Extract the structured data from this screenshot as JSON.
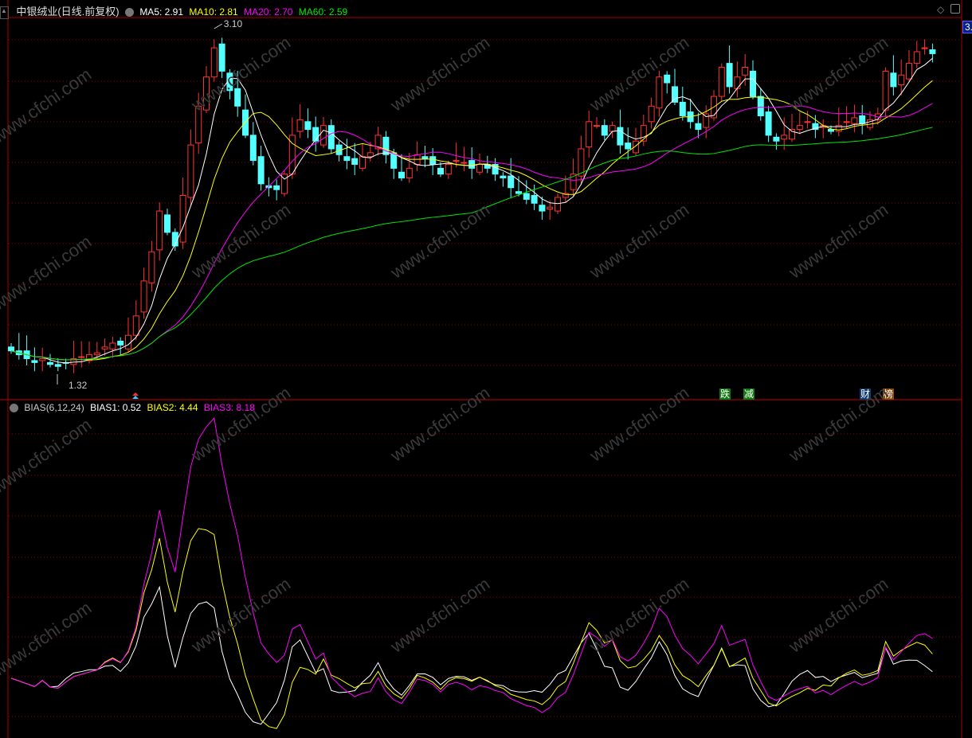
{
  "header": {
    "title": "中银绒业(日线.前复权)",
    "ma5": "MA5: 2.91",
    "ma10": "MA10: 2.81",
    "ma20": "MA20: 2.70",
    "ma60": "MA60: 2.59",
    "price_tag": "3."
  },
  "indicator": {
    "name": "BIAS(6,12,24)",
    "bias1": "BIAS1: 0.52",
    "bias2": "BIAS2: 4.44",
    "bias3": "BIAS3: 8.18"
  },
  "event_tags": [
    "跌",
    "减",
    "财",
    "榜"
  ],
  "watermark": "www.cfchi.com",
  "colors": {
    "up": "#ff3232",
    "down": "#54ffff",
    "ma5": "#ffffff",
    "ma10": "#ffff00",
    "ma20": "#ff00ff",
    "ma60": "#00e600",
    "grid": "#8b0000"
  },
  "chart_data": {
    "type": "candlestick",
    "title": "中银绒业(日线.前复权)",
    "high_label": "3.10",
    "low_label": "1.32",
    "ylim": [
      1.32,
      3.1
    ],
    "closes": [
      1.44,
      1.42,
      1.4,
      1.38,
      1.4,
      1.37,
      1.36,
      1.38,
      1.4,
      1.41,
      1.42,
      1.43,
      1.46,
      1.48,
      1.47,
      1.52,
      1.62,
      1.8,
      1.95,
      2.16,
      2.05,
      1.98,
      2.24,
      2.5,
      2.7,
      2.85,
      3.0,
      2.88,
      2.78,
      2.7,
      2.55,
      2.42,
      2.3,
      2.28,
      2.27,
      2.35,
      2.55,
      2.63,
      2.58,
      2.52,
      2.6,
      2.48,
      2.45,
      2.42,
      2.4,
      2.44,
      2.46,
      2.55,
      2.45,
      2.38,
      2.33,
      2.38,
      2.45,
      2.43,
      2.4,
      2.35,
      2.4,
      2.42,
      2.41,
      2.38,
      2.4,
      2.38,
      2.35,
      2.33,
      2.28,
      2.25,
      2.22,
      2.2,
      2.16,
      2.18,
      2.23,
      2.25,
      2.35,
      2.48,
      2.62,
      2.6,
      2.55,
      2.6,
      2.5,
      2.48,
      2.52,
      2.6,
      2.7,
      2.85,
      2.82,
      2.72,
      2.65,
      2.62,
      2.58,
      2.66,
      2.75,
      2.9,
      2.8,
      2.85,
      2.9,
      2.75,
      2.65,
      2.55,
      2.52,
      2.55,
      2.58,
      2.6,
      2.62,
      2.58,
      2.6,
      2.57,
      2.6,
      2.62,
      2.64,
      2.61,
      2.63,
      2.66,
      2.88,
      2.8,
      2.86,
      2.92,
      2.98,
      3.0,
      2.97
    ],
    "ma_periods": [
      5,
      10,
      20,
      60
    ],
    "bias_periods": [
      6,
      12,
      24
    ]
  }
}
